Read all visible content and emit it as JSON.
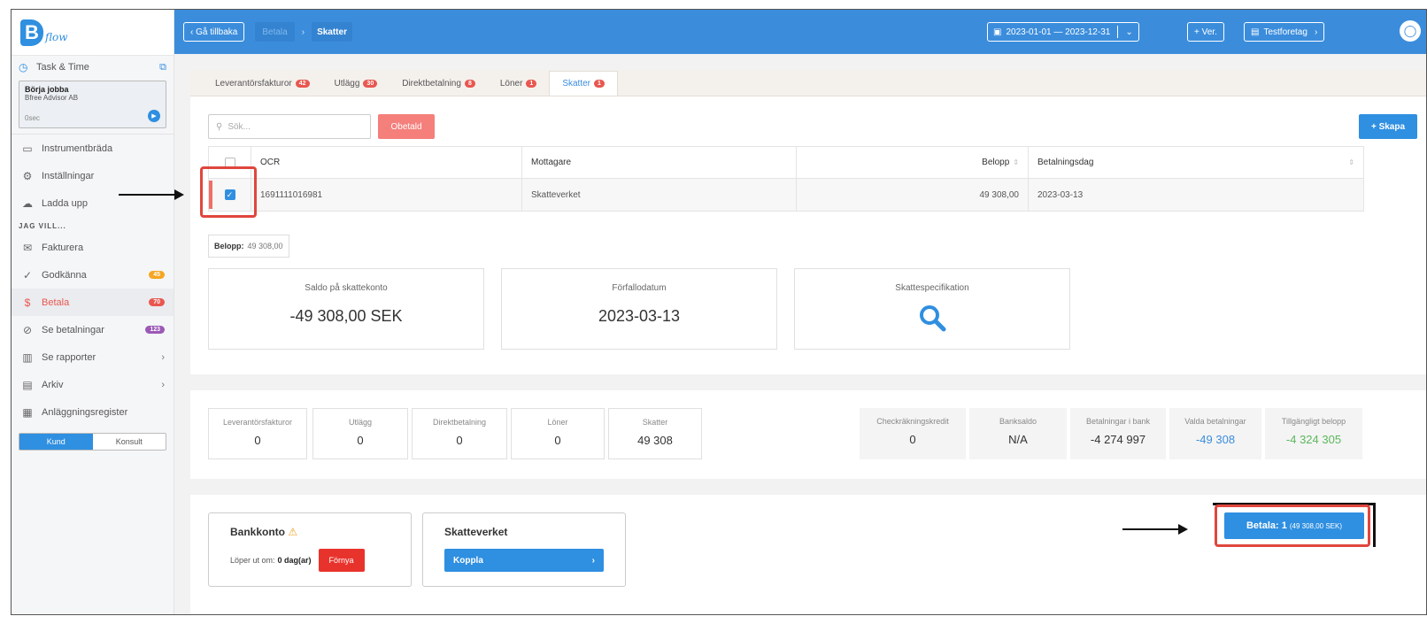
{
  "sidebar": {
    "logo_text": "flow",
    "task_label": "Task & Time",
    "task_card": {
      "title": "Börja jobba",
      "company": "Bfree Advisor AB",
      "time": "0sec"
    },
    "nav_top": [
      {
        "label": "Instrumentbräda",
        "icon": "monitor-icon"
      },
      {
        "label": "Inställningar",
        "icon": "gear-icon"
      },
      {
        "label": "Ladda upp",
        "icon": "upload-cloud-icon"
      }
    ],
    "section_label": "JAG VILL...",
    "nav_main": [
      {
        "label": "Fakturera",
        "icon": "mail-icon",
        "badge": "",
        "badge_color": ""
      },
      {
        "label": "Godkänna",
        "icon": "check-icon",
        "badge": "45",
        "badge_color": "#f5a623"
      },
      {
        "label": "Betala",
        "icon": "dollar-icon",
        "badge": "70",
        "badge_color": "#e9574f"
      },
      {
        "label": "Se betalningar",
        "icon": "check-circle-icon",
        "badge": "123",
        "badge_color": "#9b59b6"
      },
      {
        "label": "Se rapporter",
        "icon": "bar-chart-icon",
        "chevron": true
      },
      {
        "label": "Arkiv",
        "icon": "archive-icon",
        "chevron": true
      },
      {
        "label": "Anläggningsregister",
        "icon": "building-icon"
      }
    ],
    "toggle": {
      "left": "Kund",
      "right": "Konsult"
    }
  },
  "topbar": {
    "back_label": "‹ Gå tillbaka",
    "crumb_parent": "Betala",
    "crumb_current": "Skatter",
    "date_range": "2023-01-01 — 2023-12-31",
    "ver_label": "+ Ver.",
    "org_label": "Testforetag"
  },
  "tabs": [
    {
      "label": "Leverantörsfakturor",
      "count": "42"
    },
    {
      "label": "Utlägg",
      "count": "30"
    },
    {
      "label": "Direktbetalning",
      "count": "8"
    },
    {
      "label": "Löner",
      "count": "1"
    },
    {
      "label": "Skatter",
      "count": "1"
    }
  ],
  "toolbar": {
    "search_placeholder": "Sök...",
    "filter_label": "Obetald",
    "create_label": "+ Skapa"
  },
  "table": {
    "headers": {
      "ocr": "OCR",
      "recipient": "Mottagare",
      "amount": "Belopp",
      "pay_date": "Betalningsdag"
    },
    "rows": [
      {
        "ocr": "1691111016981",
        "recipient": "Skatteverket",
        "amount": "49 308,00",
        "pay_date": "2023-03-13",
        "checked": true
      }
    ]
  },
  "summary": {
    "label": "Belopp:",
    "value": "49 308,00"
  },
  "cards": [
    {
      "title": "Saldo på skattekonto",
      "value": "-49 308,00 SEK"
    },
    {
      "title": "Förfallodatum",
      "value": "2023-03-13"
    },
    {
      "title": "Skattespecifikation",
      "icon": "search-icon"
    }
  ],
  "totals": [
    {
      "label": "Leverantörsfakturor",
      "value": "0"
    },
    {
      "label": "Utlägg",
      "value": "0"
    },
    {
      "label": "Direktbetalning",
      "value": "0"
    },
    {
      "label": "Löner",
      "value": "0"
    },
    {
      "label": "Skatter",
      "value": "49 308"
    }
  ],
  "bank_stats": [
    {
      "label": "Checkräkningskredit",
      "value": "0",
      "color": "#333333"
    },
    {
      "label": "Banksaldo",
      "value": "N/A",
      "color": "#333333"
    },
    {
      "label": "Betalningar i bank",
      "value": "-4 274 997",
      "color": "#333333"
    },
    {
      "label": "Valda betalningar",
      "value": "-49 308",
      "color": "#3b8ddc"
    },
    {
      "label": "Tillgängligt belopp",
      "value": "-4 324 305",
      "color": "#5cb85c"
    }
  ],
  "bank_account": {
    "title": "Bankkonto",
    "expires_label": "Löper ut om:",
    "expires_value": "0 dag(ar)",
    "renew_label": "Förnya"
  },
  "tax_agency": {
    "title": "Skatteverket",
    "connect_label": "Koppla"
  },
  "pay": {
    "label": "Betala: 1",
    "amount": "(49 308,00 SEK)"
  }
}
